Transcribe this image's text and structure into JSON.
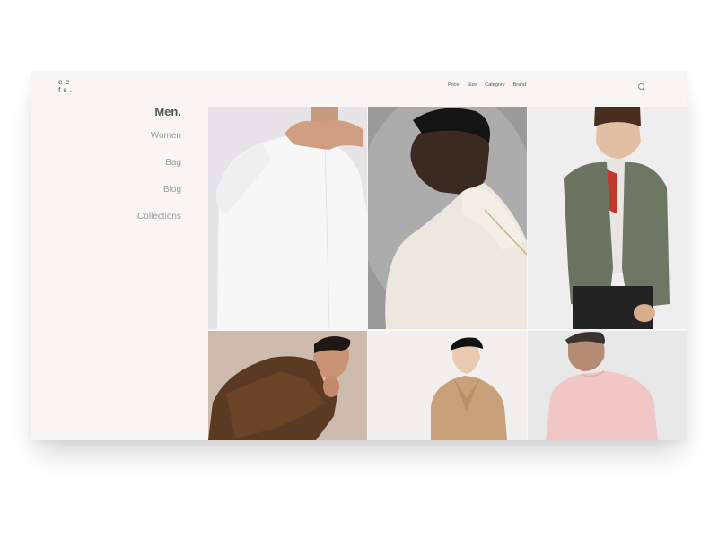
{
  "brand": {
    "line1": "ec",
    "line2": "fs."
  },
  "top_nav": [
    "Price",
    "Size",
    "Category",
    "Brand"
  ],
  "side_nav": {
    "active": "Men.",
    "items": [
      "Women",
      "Bag",
      "Blog",
      "Collections"
    ]
  },
  "icons": {
    "search": "search-icon"
  },
  "colors": {
    "background": "#f8f6f4",
    "text_dark": "#575757",
    "text_light": "#9b9b9b"
  }
}
